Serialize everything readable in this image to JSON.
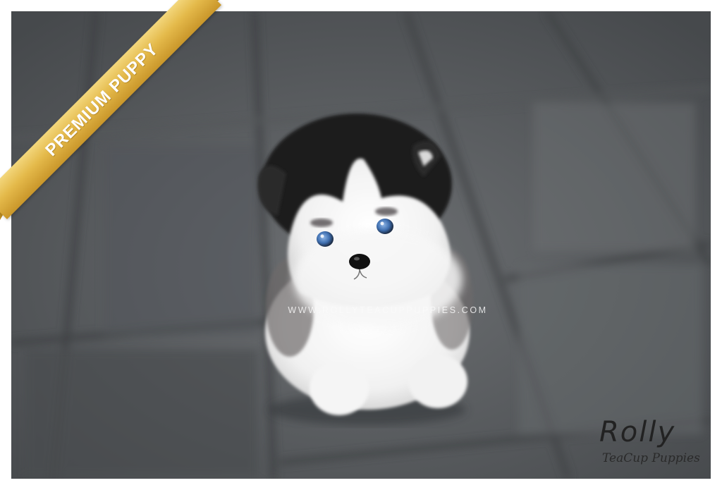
{
  "badge": {
    "text": "PREMIUM PUPPY",
    "color": "#e4b94a"
  },
  "watermark": {
    "text": "WWW.ROLLYTEACUPPUPPIES.COM"
  },
  "logo": {
    "name": "Rolly",
    "tagline": "TeaCup Puppies"
  },
  "photo": {
    "subject": "puppy-photo",
    "background": "#5d6062"
  }
}
